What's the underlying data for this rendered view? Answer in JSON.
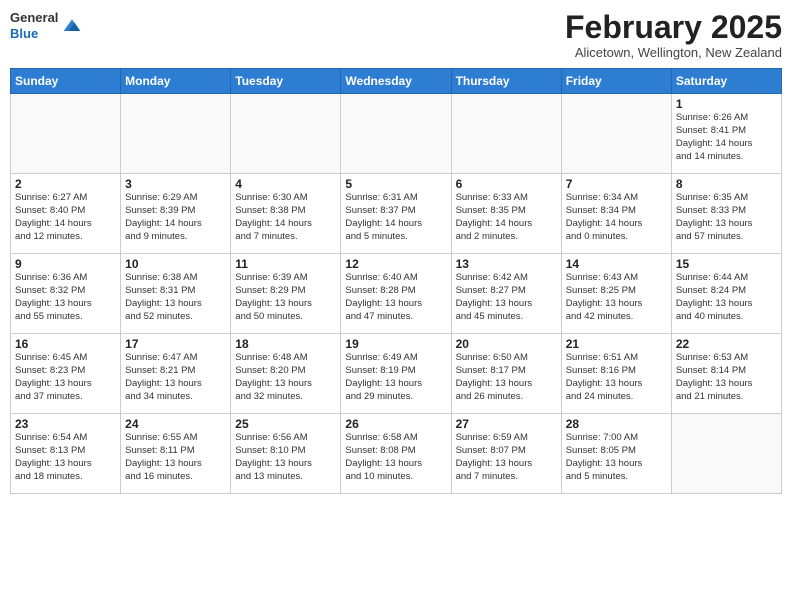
{
  "header": {
    "logo": {
      "line1": "General",
      "line2": "Blue"
    },
    "title": "February 2025",
    "location": "Alicetown, Wellington, New Zealand"
  },
  "weekdays": [
    "Sunday",
    "Monday",
    "Tuesday",
    "Wednesday",
    "Thursday",
    "Friday",
    "Saturday"
  ],
  "weeks": [
    [
      {
        "day": "",
        "info": ""
      },
      {
        "day": "",
        "info": ""
      },
      {
        "day": "",
        "info": ""
      },
      {
        "day": "",
        "info": ""
      },
      {
        "day": "",
        "info": ""
      },
      {
        "day": "",
        "info": ""
      },
      {
        "day": "1",
        "info": "Sunrise: 6:26 AM\nSunset: 8:41 PM\nDaylight: 14 hours\nand 14 minutes."
      }
    ],
    [
      {
        "day": "2",
        "info": "Sunrise: 6:27 AM\nSunset: 8:40 PM\nDaylight: 14 hours\nand 12 minutes."
      },
      {
        "day": "3",
        "info": "Sunrise: 6:29 AM\nSunset: 8:39 PM\nDaylight: 14 hours\nand 9 minutes."
      },
      {
        "day": "4",
        "info": "Sunrise: 6:30 AM\nSunset: 8:38 PM\nDaylight: 14 hours\nand 7 minutes."
      },
      {
        "day": "5",
        "info": "Sunrise: 6:31 AM\nSunset: 8:37 PM\nDaylight: 14 hours\nand 5 minutes."
      },
      {
        "day": "6",
        "info": "Sunrise: 6:33 AM\nSunset: 8:35 PM\nDaylight: 14 hours\nand 2 minutes."
      },
      {
        "day": "7",
        "info": "Sunrise: 6:34 AM\nSunset: 8:34 PM\nDaylight: 14 hours\nand 0 minutes."
      },
      {
        "day": "8",
        "info": "Sunrise: 6:35 AM\nSunset: 8:33 PM\nDaylight: 13 hours\nand 57 minutes."
      }
    ],
    [
      {
        "day": "9",
        "info": "Sunrise: 6:36 AM\nSunset: 8:32 PM\nDaylight: 13 hours\nand 55 minutes."
      },
      {
        "day": "10",
        "info": "Sunrise: 6:38 AM\nSunset: 8:31 PM\nDaylight: 13 hours\nand 52 minutes."
      },
      {
        "day": "11",
        "info": "Sunrise: 6:39 AM\nSunset: 8:29 PM\nDaylight: 13 hours\nand 50 minutes."
      },
      {
        "day": "12",
        "info": "Sunrise: 6:40 AM\nSunset: 8:28 PM\nDaylight: 13 hours\nand 47 minutes."
      },
      {
        "day": "13",
        "info": "Sunrise: 6:42 AM\nSunset: 8:27 PM\nDaylight: 13 hours\nand 45 minutes."
      },
      {
        "day": "14",
        "info": "Sunrise: 6:43 AM\nSunset: 8:25 PM\nDaylight: 13 hours\nand 42 minutes."
      },
      {
        "day": "15",
        "info": "Sunrise: 6:44 AM\nSunset: 8:24 PM\nDaylight: 13 hours\nand 40 minutes."
      }
    ],
    [
      {
        "day": "16",
        "info": "Sunrise: 6:45 AM\nSunset: 8:23 PM\nDaylight: 13 hours\nand 37 minutes."
      },
      {
        "day": "17",
        "info": "Sunrise: 6:47 AM\nSunset: 8:21 PM\nDaylight: 13 hours\nand 34 minutes."
      },
      {
        "day": "18",
        "info": "Sunrise: 6:48 AM\nSunset: 8:20 PM\nDaylight: 13 hours\nand 32 minutes."
      },
      {
        "day": "19",
        "info": "Sunrise: 6:49 AM\nSunset: 8:19 PM\nDaylight: 13 hours\nand 29 minutes."
      },
      {
        "day": "20",
        "info": "Sunrise: 6:50 AM\nSunset: 8:17 PM\nDaylight: 13 hours\nand 26 minutes."
      },
      {
        "day": "21",
        "info": "Sunrise: 6:51 AM\nSunset: 8:16 PM\nDaylight: 13 hours\nand 24 minutes."
      },
      {
        "day": "22",
        "info": "Sunrise: 6:53 AM\nSunset: 8:14 PM\nDaylight: 13 hours\nand 21 minutes."
      }
    ],
    [
      {
        "day": "23",
        "info": "Sunrise: 6:54 AM\nSunset: 8:13 PM\nDaylight: 13 hours\nand 18 minutes."
      },
      {
        "day": "24",
        "info": "Sunrise: 6:55 AM\nSunset: 8:11 PM\nDaylight: 13 hours\nand 16 minutes."
      },
      {
        "day": "25",
        "info": "Sunrise: 6:56 AM\nSunset: 8:10 PM\nDaylight: 13 hours\nand 13 minutes."
      },
      {
        "day": "26",
        "info": "Sunrise: 6:58 AM\nSunset: 8:08 PM\nDaylight: 13 hours\nand 10 minutes."
      },
      {
        "day": "27",
        "info": "Sunrise: 6:59 AM\nSunset: 8:07 PM\nDaylight: 13 hours\nand 7 minutes."
      },
      {
        "day": "28",
        "info": "Sunrise: 7:00 AM\nSunset: 8:05 PM\nDaylight: 13 hours\nand 5 minutes."
      },
      {
        "day": "",
        "info": ""
      }
    ]
  ]
}
